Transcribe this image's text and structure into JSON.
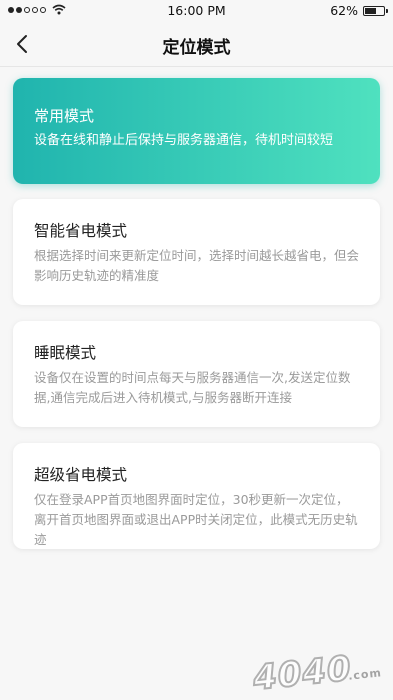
{
  "status_bar": {
    "time": "16:00 PM",
    "battery": "62%",
    "battery_level": 0.62
  },
  "nav": {
    "title": "定位模式",
    "back_icon": "chevron-left-icon"
  },
  "modes": [
    {
      "title": "常用模式",
      "desc": "设备在线和静止后保持与服务器通信，待机时间较短",
      "selected": true
    },
    {
      "title": "智能省电模式",
      "desc": "根据选择时间来更新定位时间，选择时间越长越省电，但会影响历史轨迹的精准度",
      "selected": false
    },
    {
      "title": "睡眠模式",
      "desc": "设备仅在设置的时间点每天与服务器通信一次,发送定位数据,通信完成后进入待机模式,与服务器断开连接",
      "selected": false
    },
    {
      "title": "超级省电模式",
      "desc": "仅在登录APP首页地图界面时定位，30秒更新一次定位，离开首页地图界面或退出APP时关闭定位，此模式无历史轨迹",
      "selected": false
    }
  ],
  "watermark": {
    "text": "4040",
    "suffix": ".com"
  },
  "colors": {
    "accent_start": "#20b4ae",
    "accent_end": "#4fe1bf",
    "background": "#f7f7f7"
  }
}
